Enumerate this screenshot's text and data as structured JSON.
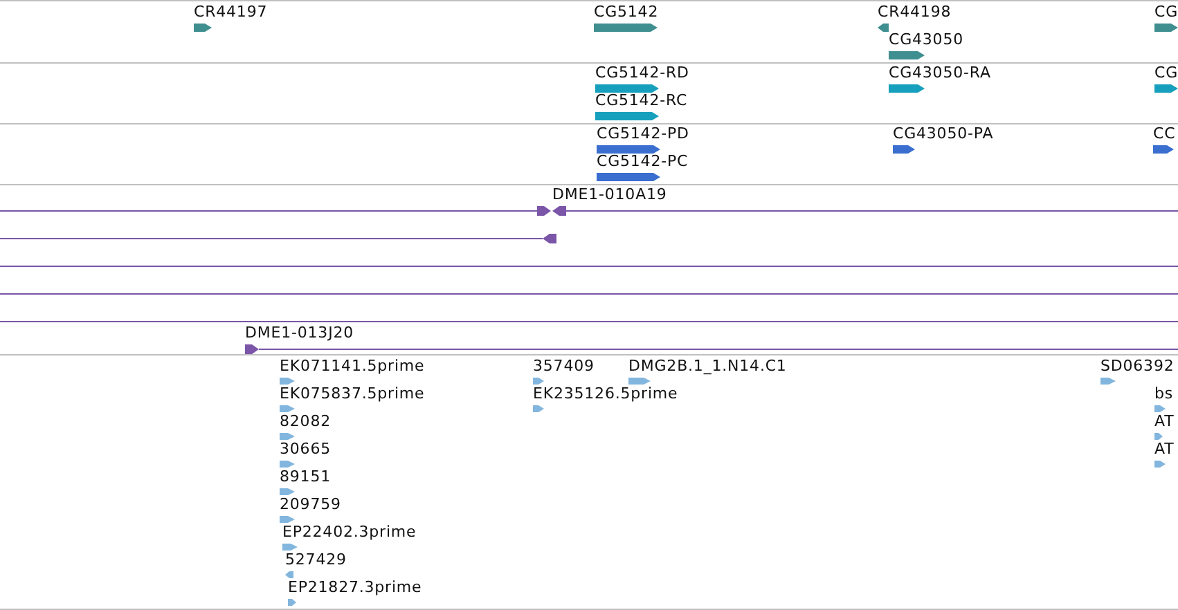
{
  "tracks": [
    {
      "kind": "gene",
      "color": "#3f8e90",
      "features": [
        {
          "label": "CR44197",
          "reverse": false
        },
        {
          "label": "CG5142",
          "reverse": false
        },
        {
          "label": "CR44198",
          "reverse": true
        },
        {
          "label": "CG43050",
          "reverse": false
        },
        {
          "label": "CG",
          "reverse": false
        }
      ]
    },
    {
      "kind": "gene",
      "color": "#16a0bd",
      "features": [
        {
          "label": "CG5142-RD",
          "reverse": false
        },
        {
          "label": "CG5142-RC",
          "reverse": false
        },
        {
          "label": "CG43050-RA",
          "reverse": false
        },
        {
          "label": "CG",
          "reverse": false
        }
      ]
    },
    {
      "kind": "gene",
      "color": "#3a6fd0",
      "features": [
        {
          "label": "CG5142-PD",
          "reverse": false
        },
        {
          "label": "CG5142-PC",
          "reverse": false
        },
        {
          "label": "CG43050-PA",
          "reverse": false
        },
        {
          "label": "CC",
          "reverse": false
        }
      ]
    },
    {
      "kind": "clone",
      "color": "#7a55a8",
      "features": [
        {
          "kind": "line",
          "label": "DME1-010A19",
          "arrows": [
            {
              "reverse": false
            },
            {
              "reverse": true
            }
          ]
        },
        {
          "kind": "line",
          "arrows": [
            {
              "reverse": true
            }
          ]
        },
        {
          "kind": "line"
        },
        {
          "kind": "line"
        },
        {
          "kind": "line"
        },
        {
          "kind": "line",
          "label": "DME1-013J20",
          "arrows": [
            {
              "reverse": false
            }
          ]
        }
      ]
    },
    {
      "kind": "est",
      "color": "#82b6de",
      "features": [
        {
          "label": "EK071141.5prime",
          "reverse": false
        },
        {
          "label": "EK075837.5prime",
          "reverse": false
        },
        {
          "label": "82082",
          "reverse": false
        },
        {
          "label": "30665",
          "reverse": false
        },
        {
          "label": "89151",
          "reverse": false
        },
        {
          "label": "209759",
          "reverse": false
        },
        {
          "label": "EP22402.3prime",
          "reverse": false
        },
        {
          "label": "527429",
          "reverse": true
        },
        {
          "label": "EP21827.3prime",
          "reverse": false
        },
        {
          "label": "357409",
          "reverse": false
        },
        {
          "label": "EK235126.5prime",
          "reverse": false
        },
        {
          "label": "DMG2B.1_1.N14.C1",
          "reverse": false
        },
        {
          "label": "SD06392",
          "reverse": false
        },
        {
          "label": "bs",
          "reverse": false
        },
        {
          "label": "AT",
          "reverse": false
        },
        {
          "label": "AT",
          "reverse": false
        }
      ]
    }
  ]
}
